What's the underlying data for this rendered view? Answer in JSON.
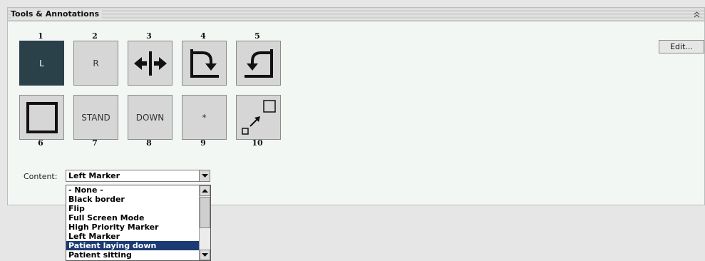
{
  "panel": {
    "title": "Tools & Annotations",
    "collapse_icon": "double-chevron-up-icon"
  },
  "tools": [
    {
      "number": "1",
      "label": "L",
      "icon": "left-marker",
      "selected": true
    },
    {
      "number": "2",
      "label": "R",
      "icon": "right-marker",
      "selected": false
    },
    {
      "number": "3",
      "label": "",
      "icon": "flip-horizontal-icon",
      "selected": false
    },
    {
      "number": "4",
      "label": "",
      "icon": "rotate-clockwise-icon",
      "selected": false
    },
    {
      "number": "5",
      "label": "",
      "icon": "rotate-counterclockwise-icon",
      "selected": false
    },
    {
      "number": "6",
      "label": "",
      "icon": "black-border-icon",
      "selected": false
    },
    {
      "number": "7",
      "label": "STAND",
      "icon": "stand-marker",
      "selected": false
    },
    {
      "number": "8",
      "label": "DOWN",
      "icon": "down-marker",
      "selected": false
    },
    {
      "number": "9",
      "label": "*",
      "icon": "priority-marker",
      "selected": false
    },
    {
      "number": "10",
      "label": "",
      "icon": "full-screen-icon",
      "selected": false
    }
  ],
  "edit_button": {
    "label": "Edit..."
  },
  "content": {
    "label": "Content:",
    "selected": "Left Marker",
    "options": [
      "- None -",
      "Black border",
      "Flip",
      "Full Screen Mode",
      "High Priority Marker",
      "Left Marker",
      "Patient laying down",
      "Patient sitting"
    ],
    "highlighted_index": 6
  },
  "colors": {
    "selected_tool_bg": "#2b4149",
    "highlight_bg": "#1c3b73",
    "panel_bg": "#f3f7f4"
  }
}
